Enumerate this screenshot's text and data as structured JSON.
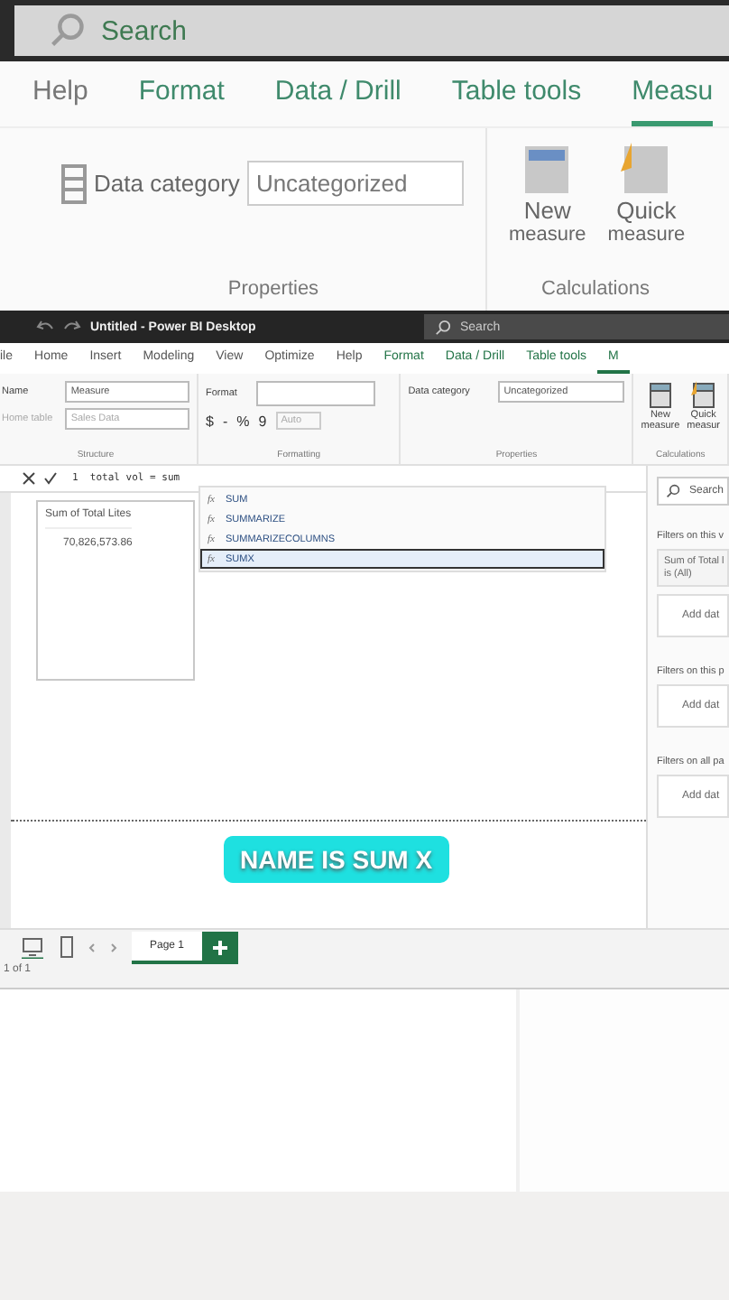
{
  "backdrop": {
    "search_placeholder": "Search",
    "tabs": [
      {
        "label": "Help",
        "selected": false
      },
      {
        "label": "Format",
        "selected": false
      },
      {
        "label": "Data / Drill",
        "selected": false
      },
      {
        "label": "Table tools",
        "selected": false
      },
      {
        "label": "Measu",
        "selected": true
      }
    ],
    "data_category_label": "Data category",
    "data_category_value": "Uncategorized",
    "buttons": [
      "New",
      "Quick"
    ],
    "button_subs": [
      "measure",
      "measure"
    ],
    "groups": [
      "Properties",
      "Calculations"
    ]
  },
  "window": {
    "title": "Untitled - Power BI Desktop",
    "search_placeholder": "Search"
  },
  "tabs": [
    {
      "label": "ile",
      "selected": false,
      "accent": false
    },
    {
      "label": "Home",
      "selected": false,
      "accent": false
    },
    {
      "label": "Insert",
      "selected": false,
      "accent": false
    },
    {
      "label": "Modeling",
      "selected": false,
      "accent": false
    },
    {
      "label": "View",
      "selected": false,
      "accent": false
    },
    {
      "label": "Optimize",
      "selected": false,
      "accent": false
    },
    {
      "label": "Help",
      "selected": false,
      "accent": false
    },
    {
      "label": "Format",
      "selected": false,
      "accent": true
    },
    {
      "label": "Data / Drill",
      "selected": false,
      "accent": true
    },
    {
      "label": "Table tools",
      "selected": false,
      "accent": true
    },
    {
      "label": "M",
      "selected": true,
      "accent": true
    }
  ],
  "ribbon": {
    "structure": {
      "name_label": "Name",
      "name_value": "Measure",
      "home_label": "Home table",
      "home_value": "Sales Data",
      "group": "Structure"
    },
    "formatting": {
      "format_label": "Format",
      "symbols": [
        "$",
        "-",
        "%",
        "9",
        "Auto"
      ],
      "group": "Formatting"
    },
    "properties": {
      "label": "Data category",
      "value": "Uncategorized",
      "group": "Properties"
    },
    "calculations": {
      "buttons": [
        {
          "line1": "New",
          "line2": "measure"
        },
        {
          "line1": "Quick",
          "line2": "measur"
        }
      ],
      "group": "Calculations"
    }
  },
  "formula": {
    "line_number": "1",
    "text": "total vol = sum"
  },
  "suggestions": [
    {
      "fx": "fx",
      "name": "SUM",
      "selected": false
    },
    {
      "fx": "fx",
      "name": "SUMMARIZE",
      "selected": false
    },
    {
      "fx": "fx",
      "name": "SUMMARIZECOLUMNS",
      "selected": false
    },
    {
      "fx": "fx",
      "name": "SUMX",
      "selected": true
    }
  ],
  "visual": {
    "header": "Sum of Total Lites",
    "value": "70,826,573.86"
  },
  "filters": {
    "search_placeholder": "Search",
    "sections": [
      {
        "title": "Filters on this v",
        "card": {
          "line1": "Sum of Total l",
          "line2": "is (All)"
        },
        "add": "Add dat"
      },
      {
        "title": "Filters on this p",
        "add": "Add dat"
      },
      {
        "title": "Filters on all pa",
        "add": "Add dat"
      }
    ]
  },
  "caption": "NAME IS SUM X",
  "pages": [
    {
      "label": "Page 1",
      "selected": true
    }
  ],
  "status": "1 of 1"
}
